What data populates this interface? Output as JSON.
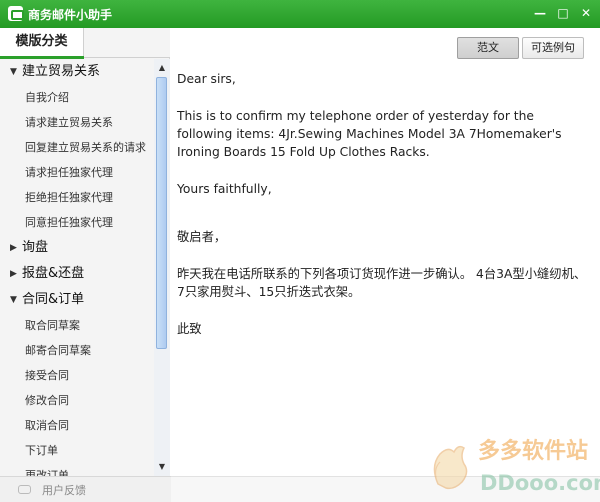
{
  "app": {
    "title": "商务邮件小助手"
  },
  "window_controls": [
    "—",
    "□",
    "✕"
  ],
  "sidebar": {
    "tab_label": "模版分类",
    "categories": [
      {
        "label": "建立贸易关系",
        "expanded": true,
        "items": [
          "自我介绍",
          "请求建立贸易关系",
          "回复建立贸易关系的请求",
          "请求担任独家代理",
          "拒绝担任独家代理",
          "同意担任独家代理"
        ]
      },
      {
        "label": "询盘",
        "expanded": false,
        "items": []
      },
      {
        "label": "报盘&还盘",
        "expanded": false,
        "items": []
      },
      {
        "label": "合同&订单",
        "expanded": true,
        "items": [
          "取合同草案",
          "邮寄合同草案",
          "接受合同",
          "修改合同",
          "取消合同",
          "下订单",
          "更改订单"
        ]
      }
    ]
  },
  "toolbar": {
    "fanwen_label": "范文",
    "kexuan_label": "可选例句"
  },
  "letter": {
    "greeting": "Dear sirs,",
    "body": "This is to confirm my telephone order of yesterday for the following items: 4Jr.Sewing Machines Model 3A 7Homemaker's Ironing Boards 15 Fold Up Clothes Racks.",
    "closing": "Yours faithfully,",
    "cn_greeting": "敬启者，",
    "cn_body": "昨天我在电话所联系的下列各项订货现作进一步确认。 4台3A型小缝纫机、7只家用熨斗、15只折迭式衣架。",
    "cn_closing": "此致"
  },
  "footer": {
    "feedback_label": "用户反馈"
  },
  "watermark": {
    "site_name": "多多软件站",
    "domain": "DDooo.com"
  },
  "colors": {
    "accent": "#2aa02a",
    "title_bar": "#2ea52e",
    "watermark_orange": "#f0a040",
    "watermark_green": "#80c0a0"
  }
}
